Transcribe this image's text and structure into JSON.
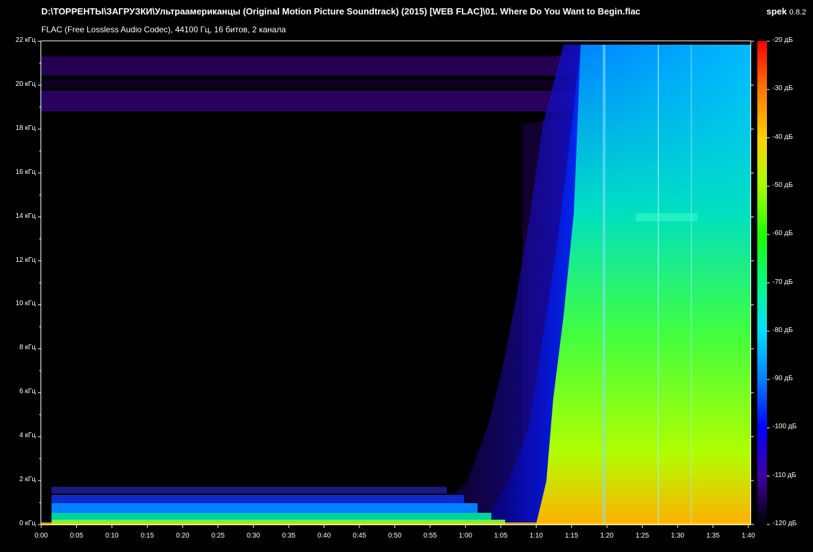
{
  "header": {
    "file_path": "D:\\ТОРРЕНТЫ\\ЗАГРУЗКИ\\Ультраамериканцы (Original Motion Picture Soundtrack) (2015) [WEB FLAC]\\01. Where Do You Want to Begin.flac",
    "format_info": "FLAC (Free Lossless Audio Codec), 44100 Гц, 16 битов, 2 канала",
    "app_name": "spek",
    "app_version": "0.8.2"
  },
  "spectrogram": {
    "frequency_ticks": [
      "0 кГц",
      "2 кГц",
      "4 кГц",
      "6 кГц",
      "8 кГц",
      "10 кГц",
      "12 кГц",
      "14 кГц",
      "16 кГц",
      "18 кГц",
      "20 кГц",
      "22 кГц"
    ],
    "frequency_values_khz": [
      0,
      2,
      4,
      6,
      8,
      10,
      12,
      14,
      16,
      18,
      20,
      22
    ],
    "time_ticks": [
      "0:00",
      "0:05",
      "0:10",
      "0:15",
      "0:20",
      "0:25",
      "0:30",
      "0:35",
      "0:40",
      "0:45",
      "0:50",
      "0:55",
      "1:00",
      "1:05",
      "1:10",
      "1:15",
      "1:20",
      "1:25",
      "1:30",
      "1:35",
      "1:40"
    ],
    "time_values_s": [
      0,
      5,
      10,
      15,
      20,
      25,
      30,
      35,
      40,
      45,
      50,
      55,
      60,
      65,
      70,
      75,
      80,
      85,
      90,
      95,
      100
    ],
    "time_max_s": 100.3,
    "freq_max_khz": 22
  },
  "colorbar": {
    "ticks": [
      "-20 дБ",
      "-30 дБ",
      "-40 дБ",
      "-50 дБ",
      "-60 дБ",
      "-70 дБ",
      "-80 дБ",
      "-90 дБ",
      "-100 дБ",
      "-110 дБ",
      "-120 дБ"
    ],
    "values_db": [
      -20,
      -30,
      -40,
      -50,
      -60,
      -70,
      -80,
      -90,
      -100,
      -110,
      -120
    ],
    "colors": [
      "#ff0000",
      "#ff7800",
      "#ffd000",
      "#a8ff00",
      "#20ff00",
      "#00ff80",
      "#00e0ff",
      "#0080ff",
      "#0000ff",
      "#4000a0",
      "#000000"
    ]
  }
}
